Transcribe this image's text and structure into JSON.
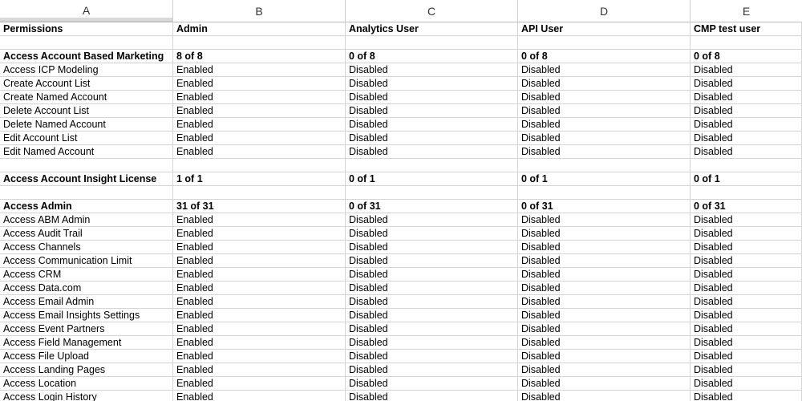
{
  "columns": [
    "A",
    "B",
    "C",
    "D",
    "E"
  ],
  "rows": [
    {
      "style": "header",
      "cells": [
        "Permissions",
        "Admin",
        "Analytics User",
        "API User",
        "CMP test user"
      ]
    },
    {
      "style": "blank",
      "cells": [
        "",
        "",
        "",
        "",
        ""
      ]
    },
    {
      "style": "bold",
      "cells": [
        "Access Account Based Marketing",
        "8 of 8",
        "0 of 8",
        "0 of 8",
        "0 of 8"
      ]
    },
    {
      "style": "normal",
      "cells": [
        "Access ICP Modeling",
        "Enabled",
        "Disabled",
        "Disabled",
        "Disabled"
      ]
    },
    {
      "style": "normal",
      "cells": [
        "Create Account List",
        "Enabled",
        "Disabled",
        "Disabled",
        "Disabled"
      ]
    },
    {
      "style": "normal",
      "cells": [
        "Create Named Account",
        "Enabled",
        "Disabled",
        "Disabled",
        "Disabled"
      ]
    },
    {
      "style": "normal",
      "cells": [
        "Delete Account List",
        "Enabled",
        "Disabled",
        "Disabled",
        "Disabled"
      ]
    },
    {
      "style": "normal",
      "cells": [
        "Delete Named Account",
        "Enabled",
        "Disabled",
        "Disabled",
        "Disabled"
      ]
    },
    {
      "style": "normal",
      "cells": [
        "Edit Account List",
        "Enabled",
        "Disabled",
        "Disabled",
        "Disabled"
      ]
    },
    {
      "style": "normal",
      "cells": [
        "Edit Named Account",
        "Enabled",
        "Disabled",
        "Disabled",
        "Disabled"
      ]
    },
    {
      "style": "blank",
      "cells": [
        "",
        "",
        "",
        "",
        ""
      ]
    },
    {
      "style": "bold",
      "cells": [
        "Access Account Insight License",
        "1 of 1",
        "0 of 1",
        "0 of 1",
        "0 of 1"
      ]
    },
    {
      "style": "blank",
      "cells": [
        "",
        "",
        "",
        "",
        ""
      ]
    },
    {
      "style": "bold",
      "cells": [
        "Access Admin",
        "31 of 31",
        "0 of 31",
        "0 of 31",
        "0 of 31"
      ]
    },
    {
      "style": "normal",
      "cells": [
        "Access ABM Admin",
        "Enabled",
        "Disabled",
        "Disabled",
        "Disabled"
      ]
    },
    {
      "style": "normal",
      "cells": [
        "Access Audit Trail",
        "Enabled",
        "Disabled",
        "Disabled",
        "Disabled"
      ]
    },
    {
      "style": "normal",
      "cells": [
        "Access Channels",
        "Enabled",
        "Disabled",
        "Disabled",
        "Disabled"
      ]
    },
    {
      "style": "normal",
      "cells": [
        "Access Communication Limit",
        "Enabled",
        "Disabled",
        "Disabled",
        "Disabled"
      ]
    },
    {
      "style": "normal",
      "cells": [
        "Access CRM",
        "Enabled",
        "Disabled",
        "Disabled",
        "Disabled"
      ]
    },
    {
      "style": "normal",
      "cells": [
        "Access Data.com",
        "Enabled",
        "Disabled",
        "Disabled",
        "Disabled"
      ]
    },
    {
      "style": "normal",
      "cells": [
        "Access Email Admin",
        "Enabled",
        "Disabled",
        "Disabled",
        "Disabled"
      ]
    },
    {
      "style": "normal",
      "cells": [
        "Access Email Insights Settings",
        "Enabled",
        "Disabled",
        "Disabled",
        "Disabled"
      ]
    },
    {
      "style": "normal",
      "cells": [
        "Access Event Partners",
        "Enabled",
        "Disabled",
        "Disabled",
        "Disabled"
      ]
    },
    {
      "style": "normal",
      "cells": [
        "Access Field Management",
        "Enabled",
        "Disabled",
        "Disabled",
        "Disabled"
      ]
    },
    {
      "style": "normal",
      "cells": [
        "Access File Upload",
        "Enabled",
        "Disabled",
        "Disabled",
        "Disabled"
      ]
    },
    {
      "style": "normal",
      "cells": [
        "Access Landing Pages",
        "Enabled",
        "Disabled",
        "Disabled",
        "Disabled"
      ]
    },
    {
      "style": "normal",
      "cells": [
        "Access Location",
        "Enabled",
        "Disabled",
        "Disabled",
        "Disabled"
      ]
    },
    {
      "style": "normal",
      "cells": [
        "Access Login History",
        "Enabled",
        "Disabled",
        "Disabled",
        "Disabled"
      ]
    }
  ]
}
